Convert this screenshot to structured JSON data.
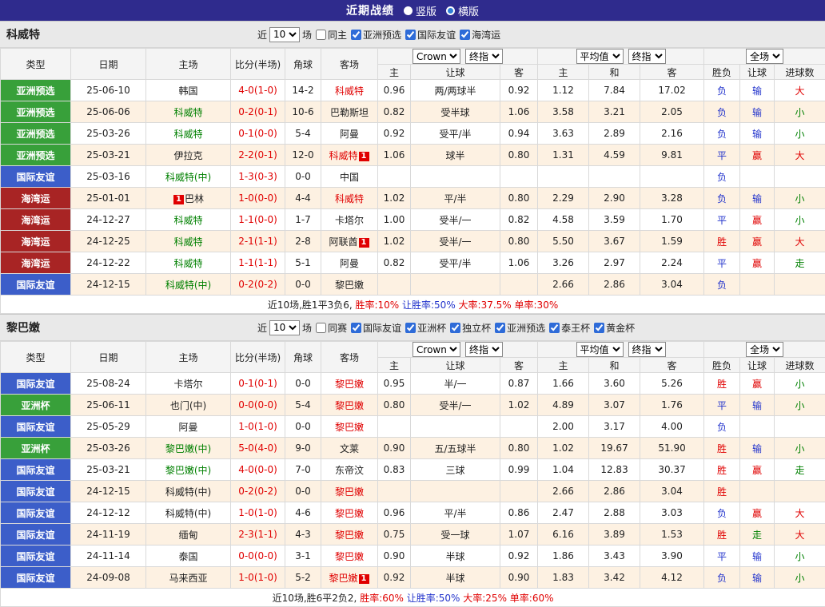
{
  "topbar": {
    "title": "近期战绩",
    "radios": [
      {
        "label": "竖版",
        "selected": false
      },
      {
        "label": "横版",
        "selected": true
      }
    ]
  },
  "colors": {
    "accent": "#2f2b8d",
    "type_bg": {
      "亚洲预选": "#38a03a",
      "国际友谊": "#3c5ec9",
      "海湾运": "#a82424",
      "亚洲杯": "#38a03a"
    }
  },
  "sections": [
    {
      "team": "科威特",
      "filters": {
        "prefix": "近",
        "count": "10",
        "suffix": "场",
        "checkboxes": [
          {
            "label": "同主",
            "checked": false
          },
          {
            "label": "亚洲预选",
            "checked": true
          },
          {
            "label": "国际友谊",
            "checked": true
          },
          {
            "label": "海湾运",
            "checked": true
          }
        ]
      },
      "header": {
        "cols": [
          "类型",
          "日期",
          "主场",
          "比分(半场)",
          "角球",
          "客场"
        ],
        "odds_selects": [
          "Crown",
          "终指"
        ],
        "avg_selects": [
          "平均值",
          "终指"
        ],
        "scope_selects": [
          "全场"
        ],
        "sub": [
          "主",
          "让球",
          "客",
          "主",
          "和",
          "客",
          "胜负",
          "让球",
          "进球数"
        ]
      },
      "rows": [
        {
          "type": "亚洲预选",
          "date": "25-06-10",
          "home": {
            "text": "韩国",
            "cls": "black"
          },
          "score": "4-0(1-0)",
          "corner": "14-2",
          "away": {
            "text": "科威特",
            "cls": "red"
          },
          "o": [
            "0.96",
            "两/两球半",
            "0.92"
          ],
          "avg": [
            "1.12",
            "7.84",
            "17.02"
          ],
          "res": {
            "text": "负",
            "cls": "blue"
          },
          "hr": {
            "text": "输",
            "cls": "blue"
          },
          "g": {
            "text": "大",
            "cls": "red"
          }
        },
        {
          "type": "亚洲预选",
          "date": "25-06-06",
          "home": {
            "text": "科威特",
            "cls": "green"
          },
          "score": "0-2(0-1)",
          "corner": "10-6",
          "away": {
            "text": "巴勒斯坦",
            "cls": "black"
          },
          "o": [
            "0.82",
            "受半球",
            "1.06"
          ],
          "avg": [
            "3.58",
            "3.21",
            "2.05"
          ],
          "res": {
            "text": "负",
            "cls": "blue"
          },
          "hr": {
            "text": "输",
            "cls": "blue"
          },
          "g": {
            "text": "小",
            "cls": "green"
          }
        },
        {
          "type": "亚洲预选",
          "date": "25-03-26",
          "home": {
            "text": "科威特",
            "cls": "green"
          },
          "score": "0-1(0-0)",
          "corner": "5-4",
          "away": {
            "text": "阿曼",
            "cls": "black"
          },
          "o": [
            "0.92",
            "受平/半",
            "0.94"
          ],
          "avg": [
            "3.63",
            "2.89",
            "2.16"
          ],
          "res": {
            "text": "负",
            "cls": "blue"
          },
          "hr": {
            "text": "输",
            "cls": "blue"
          },
          "g": {
            "text": "小",
            "cls": "green"
          }
        },
        {
          "type": "亚洲预选",
          "date": "25-03-21",
          "home": {
            "text": "伊拉克",
            "cls": "black"
          },
          "score": "2-2(0-1)",
          "corner": "12-0",
          "away": {
            "text": "科威特",
            "cls": "red",
            "card": "1"
          },
          "o": [
            "1.06",
            "球半",
            "0.80"
          ],
          "avg": [
            "1.31",
            "4.59",
            "9.81"
          ],
          "res": {
            "text": "平",
            "cls": "blue"
          },
          "hr": {
            "text": "赢",
            "cls": "red"
          },
          "g": {
            "text": "大",
            "cls": "red"
          }
        },
        {
          "type": "国际友谊",
          "date": "25-03-16",
          "home": {
            "text": "科威特(中)",
            "cls": "green"
          },
          "score": "1-3(0-3)",
          "corner": "0-0",
          "away": {
            "text": "中国",
            "cls": "black"
          },
          "o": [
            "",
            "",
            ""
          ],
          "avg": [
            "",
            "",
            ""
          ],
          "res": {
            "text": "负",
            "cls": "blue"
          },
          "hr": {
            "text": "",
            "cls": "black"
          },
          "g": {
            "text": "",
            "cls": "black"
          }
        },
        {
          "type": "海湾运",
          "date": "25-01-01",
          "home": {
            "text": "巴林",
            "cls": "black",
            "card": "1",
            "card_pos": "before"
          },
          "score": "1-0(0-0)",
          "corner": "4-4",
          "away": {
            "text": "科威特",
            "cls": "red"
          },
          "o": [
            "1.02",
            "平/半",
            "0.80"
          ],
          "avg": [
            "2.29",
            "2.90",
            "3.28"
          ],
          "res": {
            "text": "负",
            "cls": "blue"
          },
          "hr": {
            "text": "输",
            "cls": "blue"
          },
          "g": {
            "text": "小",
            "cls": "green"
          }
        },
        {
          "type": "海湾运",
          "date": "24-12-27",
          "home": {
            "text": "科威特",
            "cls": "green"
          },
          "score": "1-1(0-0)",
          "corner": "1-7",
          "away": {
            "text": "卡塔尔",
            "cls": "black"
          },
          "o": [
            "1.00",
            "受半/一",
            "0.82"
          ],
          "avg": [
            "4.58",
            "3.59",
            "1.70"
          ],
          "res": {
            "text": "平",
            "cls": "blue"
          },
          "hr": {
            "text": "赢",
            "cls": "red"
          },
          "g": {
            "text": "小",
            "cls": "green"
          }
        },
        {
          "type": "海湾运",
          "date": "24-12-25",
          "home": {
            "text": "科威特",
            "cls": "green"
          },
          "score": "2-1(1-1)",
          "corner": "2-8",
          "away": {
            "text": "阿联酋",
            "cls": "black",
            "card": "1"
          },
          "o": [
            "1.02",
            "受半/一",
            "0.80"
          ],
          "avg": [
            "5.50",
            "3.67",
            "1.59"
          ],
          "res": {
            "text": "胜",
            "cls": "red"
          },
          "hr": {
            "text": "赢",
            "cls": "red"
          },
          "g": {
            "text": "大",
            "cls": "red"
          }
        },
        {
          "type": "海湾运",
          "date": "24-12-22",
          "home": {
            "text": "科威特",
            "cls": "green"
          },
          "score": "1-1(1-1)",
          "corner": "5-1",
          "away": {
            "text": "阿曼",
            "cls": "black"
          },
          "o": [
            "0.82",
            "受平/半",
            "1.06"
          ],
          "avg": [
            "3.26",
            "2.97",
            "2.24"
          ],
          "res": {
            "text": "平",
            "cls": "blue"
          },
          "hr": {
            "text": "赢",
            "cls": "red"
          },
          "g": {
            "text": "走",
            "cls": "green"
          }
        },
        {
          "type": "国际友谊",
          "date": "24-12-15",
          "home": {
            "text": "科威特(中)",
            "cls": "green"
          },
          "score": "0-2(0-2)",
          "corner": "0-0",
          "away": {
            "text": "黎巴嫩",
            "cls": "black"
          },
          "o": [
            "",
            "",
            ""
          ],
          "avg": [
            "2.66",
            "2.86",
            "3.04"
          ],
          "res": {
            "text": "负",
            "cls": "blue"
          },
          "hr": {
            "text": "",
            "cls": "black"
          },
          "g": {
            "text": "",
            "cls": "black"
          }
        }
      ],
      "summary": [
        {
          "text": "近10场,胜1平3负6, ",
          "cls": "black"
        },
        {
          "text": "胜率:10% ",
          "cls": "red"
        },
        {
          "text": "让胜率:50% ",
          "cls": "blue"
        },
        {
          "text": "大率:37.5% ",
          "cls": "red"
        },
        {
          "text": "单率:30%",
          "cls": "red"
        }
      ]
    },
    {
      "team": "黎巴嫩",
      "filters": {
        "prefix": "近",
        "count": "10",
        "suffix": "场",
        "checkboxes": [
          {
            "label": "同赛",
            "checked": false
          },
          {
            "label": "国际友谊",
            "checked": true
          },
          {
            "label": "亚洲杯",
            "checked": true
          },
          {
            "label": "独立杯",
            "checked": true
          },
          {
            "label": "亚洲预选",
            "checked": true
          },
          {
            "label": "泰王杯",
            "checked": true
          },
          {
            "label": "黄金杯",
            "checked": true
          }
        ]
      },
      "header": {
        "cols": [
          "类型",
          "日期",
          "主场",
          "比分(半场)",
          "角球",
          "客场"
        ],
        "odds_selects": [
          "Crown",
          "终指"
        ],
        "avg_selects": [
          "平均值",
          "终指"
        ],
        "scope_selects": [
          "全场"
        ],
        "sub": [
          "主",
          "让球",
          "客",
          "主",
          "和",
          "客",
          "胜负",
          "让球",
          "进球数"
        ]
      },
      "rows": [
        {
          "type": "国际友谊",
          "date": "25-08-24",
          "home": {
            "text": "卡塔尔",
            "cls": "black"
          },
          "score": "0-1(0-1)",
          "corner": "0-0",
          "away": {
            "text": "黎巴嫩",
            "cls": "red"
          },
          "o": [
            "0.95",
            "半/一",
            "0.87"
          ],
          "avg": [
            "1.66",
            "3.60",
            "5.26"
          ],
          "res": {
            "text": "胜",
            "cls": "red"
          },
          "hr": {
            "text": "赢",
            "cls": "red"
          },
          "g": {
            "text": "小",
            "cls": "green"
          }
        },
        {
          "type": "亚洲杯",
          "date": "25-06-11",
          "home": {
            "text": "也门(中)",
            "cls": "black"
          },
          "score": "0-0(0-0)",
          "corner": "5-4",
          "away": {
            "text": "黎巴嫩",
            "cls": "red"
          },
          "o": [
            "0.80",
            "受半/一",
            "1.02"
          ],
          "avg": [
            "4.89",
            "3.07",
            "1.76"
          ],
          "res": {
            "text": "平",
            "cls": "blue"
          },
          "hr": {
            "text": "输",
            "cls": "blue"
          },
          "g": {
            "text": "小",
            "cls": "green"
          }
        },
        {
          "type": "国际友谊",
          "date": "25-05-29",
          "home": {
            "text": "阿曼",
            "cls": "black"
          },
          "score": "1-0(1-0)",
          "corner": "0-0",
          "away": {
            "text": "黎巴嫩",
            "cls": "red"
          },
          "o": [
            "",
            "",
            ""
          ],
          "avg": [
            "2.00",
            "3.17",
            "4.00"
          ],
          "res": {
            "text": "负",
            "cls": "blue"
          },
          "hr": {
            "text": "",
            "cls": "black"
          },
          "g": {
            "text": "",
            "cls": "black"
          }
        },
        {
          "type": "亚洲杯",
          "date": "25-03-26",
          "home": {
            "text": "黎巴嫩(中)",
            "cls": "green"
          },
          "score": "5-0(4-0)",
          "corner": "9-0",
          "away": {
            "text": "文莱",
            "cls": "black"
          },
          "o": [
            "0.90",
            "五/五球半",
            "0.80"
          ],
          "avg": [
            "1.02",
            "19.67",
            "51.90"
          ],
          "res": {
            "text": "胜",
            "cls": "red"
          },
          "hr": {
            "text": "输",
            "cls": "blue"
          },
          "g": {
            "text": "小",
            "cls": "green"
          }
        },
        {
          "type": "国际友谊",
          "date": "25-03-21",
          "home": {
            "text": "黎巴嫩(中)",
            "cls": "green"
          },
          "score": "4-0(0-0)",
          "corner": "7-0",
          "away": {
            "text": "东帝汶",
            "cls": "black"
          },
          "o": [
            "0.83",
            "三球",
            "0.99"
          ],
          "avg": [
            "1.04",
            "12.83",
            "30.37"
          ],
          "res": {
            "text": "胜",
            "cls": "red"
          },
          "hr": {
            "text": "赢",
            "cls": "red"
          },
          "g": {
            "text": "走",
            "cls": "green"
          }
        },
        {
          "type": "国际友谊",
          "date": "24-12-15",
          "home": {
            "text": "科威特(中)",
            "cls": "black"
          },
          "score": "0-2(0-2)",
          "corner": "0-0",
          "away": {
            "text": "黎巴嫩",
            "cls": "red"
          },
          "o": [
            "",
            "",
            ""
          ],
          "avg": [
            "2.66",
            "2.86",
            "3.04"
          ],
          "res": {
            "text": "胜",
            "cls": "red"
          },
          "hr": {
            "text": "",
            "cls": "black"
          },
          "g": {
            "text": "",
            "cls": "black"
          }
        },
        {
          "type": "国际友谊",
          "date": "24-12-12",
          "home": {
            "text": "科威特(中)",
            "cls": "black"
          },
          "score": "1-0(1-0)",
          "corner": "4-6",
          "away": {
            "text": "黎巴嫩",
            "cls": "red"
          },
          "o": [
            "0.96",
            "平/半",
            "0.86"
          ],
          "avg": [
            "2.47",
            "2.88",
            "3.03"
          ],
          "res": {
            "text": "负",
            "cls": "blue"
          },
          "hr": {
            "text": "赢",
            "cls": "red"
          },
          "g": {
            "text": "大",
            "cls": "red"
          }
        },
        {
          "type": "国际友谊",
          "date": "24-11-19",
          "home": {
            "text": "缅甸",
            "cls": "black"
          },
          "score": "2-3(1-1)",
          "corner": "4-3",
          "away": {
            "text": "黎巴嫩",
            "cls": "red"
          },
          "o": [
            "0.75",
            "受一球",
            "1.07"
          ],
          "avg": [
            "6.16",
            "3.89",
            "1.53"
          ],
          "res": {
            "text": "胜",
            "cls": "red"
          },
          "hr": {
            "text": "走",
            "cls": "green"
          },
          "g": {
            "text": "大",
            "cls": "red"
          }
        },
        {
          "type": "国际友谊",
          "date": "24-11-14",
          "home": {
            "text": "泰国",
            "cls": "black"
          },
          "score": "0-0(0-0)",
          "corner": "3-1",
          "away": {
            "text": "黎巴嫩",
            "cls": "red"
          },
          "o": [
            "0.90",
            "半球",
            "0.92"
          ],
          "avg": [
            "1.86",
            "3.43",
            "3.90"
          ],
          "res": {
            "text": "平",
            "cls": "blue"
          },
          "hr": {
            "text": "输",
            "cls": "blue"
          },
          "g": {
            "text": "小",
            "cls": "green"
          }
        },
        {
          "type": "国际友谊",
          "date": "24-09-08",
          "home": {
            "text": "马来西亚",
            "cls": "black"
          },
          "score": "1-0(1-0)",
          "corner": "5-2",
          "away": {
            "text": "黎巴嫩",
            "cls": "red",
            "card": "1"
          },
          "o": [
            "0.92",
            "半球",
            "0.90"
          ],
          "avg": [
            "1.83",
            "3.42",
            "4.12"
          ],
          "res": {
            "text": "负",
            "cls": "blue"
          },
          "hr": {
            "text": "输",
            "cls": "blue"
          },
          "g": {
            "text": "小",
            "cls": "green"
          }
        }
      ],
      "summary": [
        {
          "text": "近10场,胜6平2负2, ",
          "cls": "black"
        },
        {
          "text": "胜率:60% ",
          "cls": "red"
        },
        {
          "text": "让胜率:50% ",
          "cls": "blue"
        },
        {
          "text": "大率:25% ",
          "cls": "red"
        },
        {
          "text": "单率:60%",
          "cls": "red"
        }
      ]
    }
  ]
}
